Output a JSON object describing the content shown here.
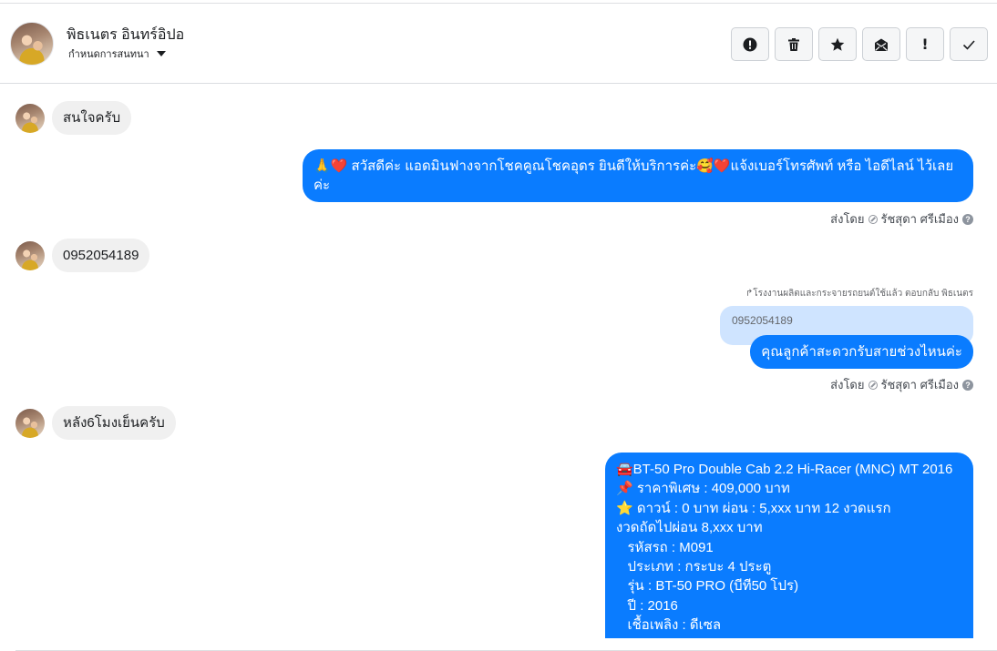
{
  "header": {
    "name": "พิธเนตร อินทร์อิปอ",
    "subtitle": "กำหนดการสนทนา",
    "actions": [
      {
        "icon": "alert-circle-icon"
      },
      {
        "icon": "trash-icon"
      },
      {
        "icon": "star-icon"
      },
      {
        "icon": "mail-icon"
      },
      {
        "icon": "exclamation-icon",
        "label": "!"
      },
      {
        "icon": "check-icon"
      }
    ]
  },
  "messages": {
    "m1": "สนใจครับ",
    "m2_emoji_prefix": "🙏❤️",
    "m2_line1": "สวัสดีค่ะ แอดมินฟางจากโชคคูณโชคอุดร ยินดีให้บริการค่ะ🥰❤️แจ้งเบอร์โทรศัพท์ หรือ ไอดีไลน์  ไว้เลย",
    "m2_line2": "ค่ะ",
    "m3": "0952054189",
    "reply_note": "↱โรงงานผลิตและกระจายรถยนต์ใช้แล้ว ตอบกลับ พิธเนตร",
    "quoted": "0952054189",
    "m4": "คุณลูกค้าสะดวกรับสายช่วงไหนค่ะ",
    "m5": "หลัง6โมงเย็นครับ",
    "car_lines": [
      "🚘BT-50 Pro Double Cab 2.2 Hi-Racer (MNC) MT 2016",
      "📌 ราคาพิเศษ : 409,000 บาท",
      "⭐ ดาวน์ : 0 บาท ผ่อน : 5,xxx บาท 12 งวดแรก",
      "งวดถัดไปผ่อน  8,xxx บาท",
      "   รหัสรถ : M091",
      "   ประเภท : กระบะ 4 ประตู",
      "   รุ่น : BT-50 PRO (บีที50 โปร)",
      "   ปี : 2016",
      "   เชื้อเพลิง : ดีเซล"
    ]
  },
  "sent_by": {
    "prefix": "ส่งโดย",
    "agent": "รัชสุดา ศรีเมือง"
  },
  "colors": {
    "outgoing_bubble": "#0a7cff",
    "incoming_bubble": "#f0f0f0",
    "quoted_bubble": "#cfe4ff"
  }
}
